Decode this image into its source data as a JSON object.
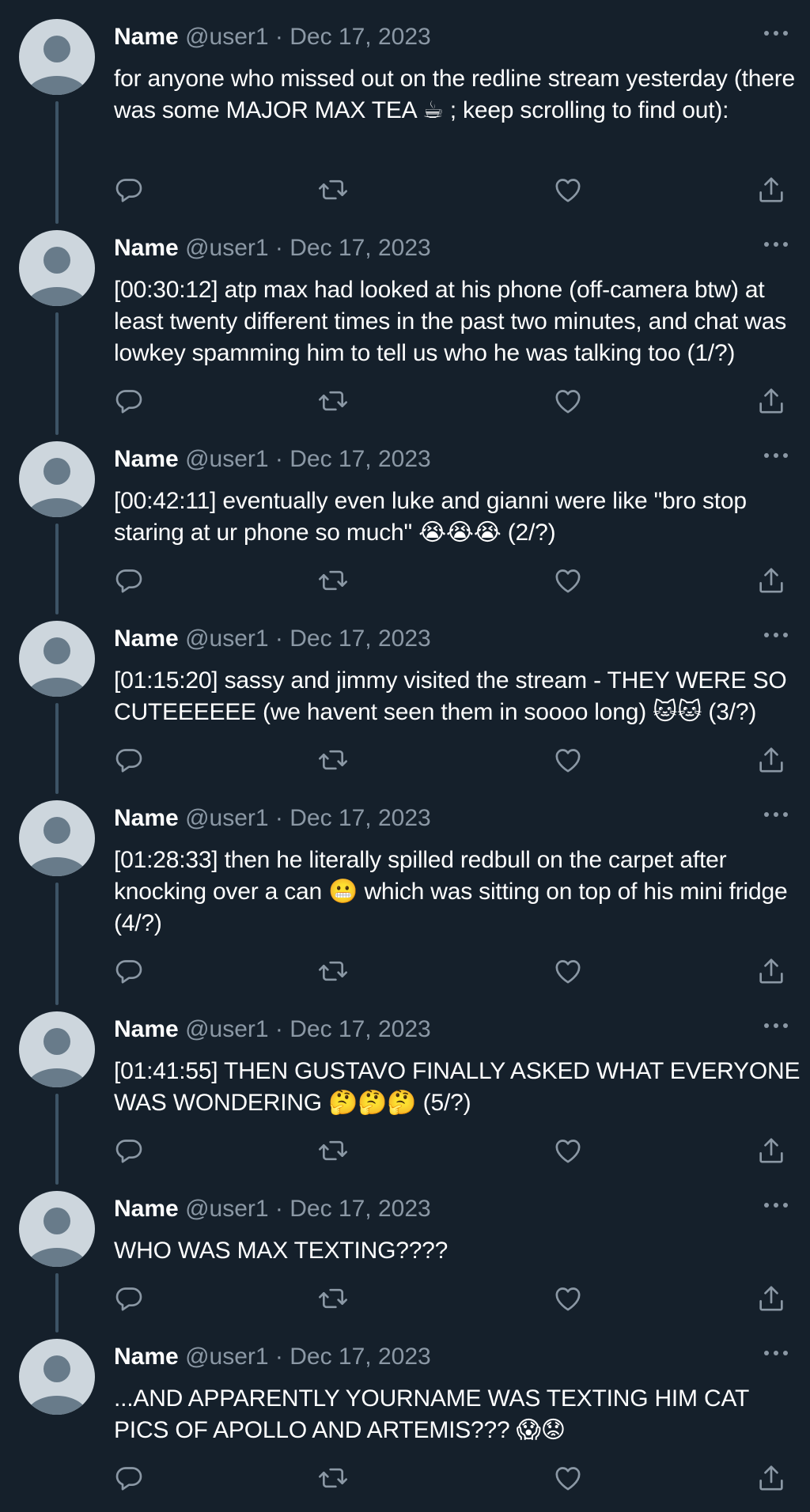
{
  "colors": {
    "background": "#15202b",
    "text": "#ffffff",
    "secondary_text": "#8b98a5",
    "thread_line": "#3d5466",
    "avatar_bg": "#cdd6dd",
    "avatar_fg": "#687b8a"
  },
  "icons": {
    "reply": "speech-bubble",
    "retweet": "loop-arrows",
    "like": "heart",
    "share": "upload-arrow",
    "more": "horizontal-ellipsis"
  },
  "tweets": [
    {
      "name": "Name",
      "handle": "@user1",
      "separator": "·",
      "date": "Dec 17, 2023",
      "text": "for anyone who missed out on the redline stream yesterday (there was some MAJOR MAX TEA ☕ ; keep scrolling to find out):"
    },
    {
      "name": "Name",
      "handle": "@user1",
      "separator": "·",
      "date": "Dec 17, 2023",
      "text": "[00:30:12] atp max had looked at his phone (off-camera btw) at least twenty different times in the past two minutes, and chat was lowkey spamming him to tell us who he was talking too (1/?)"
    },
    {
      "name": "Name",
      "handle": "@user1",
      "separator": "·",
      "date": "Dec 17, 2023",
      "text": "[00:42:11] eventually even luke and gianni were like \"bro stop staring at ur phone so much\" 😭😭😭 (2/?)"
    },
    {
      "name": "Name",
      "handle": "@user1",
      "separator": "·",
      "date": "Dec 17, 2023",
      "text": "[01:15:20] sassy and jimmy visited the stream - THEY WERE SO CUTEEEEEE (we havent seen them in soooo long) 🐱🐱 (3/?)"
    },
    {
      "name": "Name",
      "handle": "@user1",
      "separator": "·",
      "date": "Dec 17, 2023",
      "text": "[01:28:33] then he literally spilled redbull on the carpet after knocking over a can 😬 which was sitting on top of his mini fridge (4/?)"
    },
    {
      "name": "Name",
      "handle": "@user1",
      "separator": "·",
      "date": "Dec 17, 2023",
      "text": "[01:41:55] THEN GUSTAVO FINALLY ASKED WHAT EVERYONE WAS WONDERING 🤔🤔🤔 (5/?)"
    },
    {
      "name": "Name",
      "handle": "@user1",
      "separator": "·",
      "date": "Dec 17, 2023",
      "text": "WHO WAS MAX TEXTING????"
    },
    {
      "name": "Name",
      "handle": "@user1",
      "separator": "·",
      "date": "Dec 17, 2023",
      "text": "...AND APPARENTLY YOURNAME WAS TEXTING HIM CAT PICS OF APOLLO AND ARTEMIS??? 😱😟"
    }
  ]
}
